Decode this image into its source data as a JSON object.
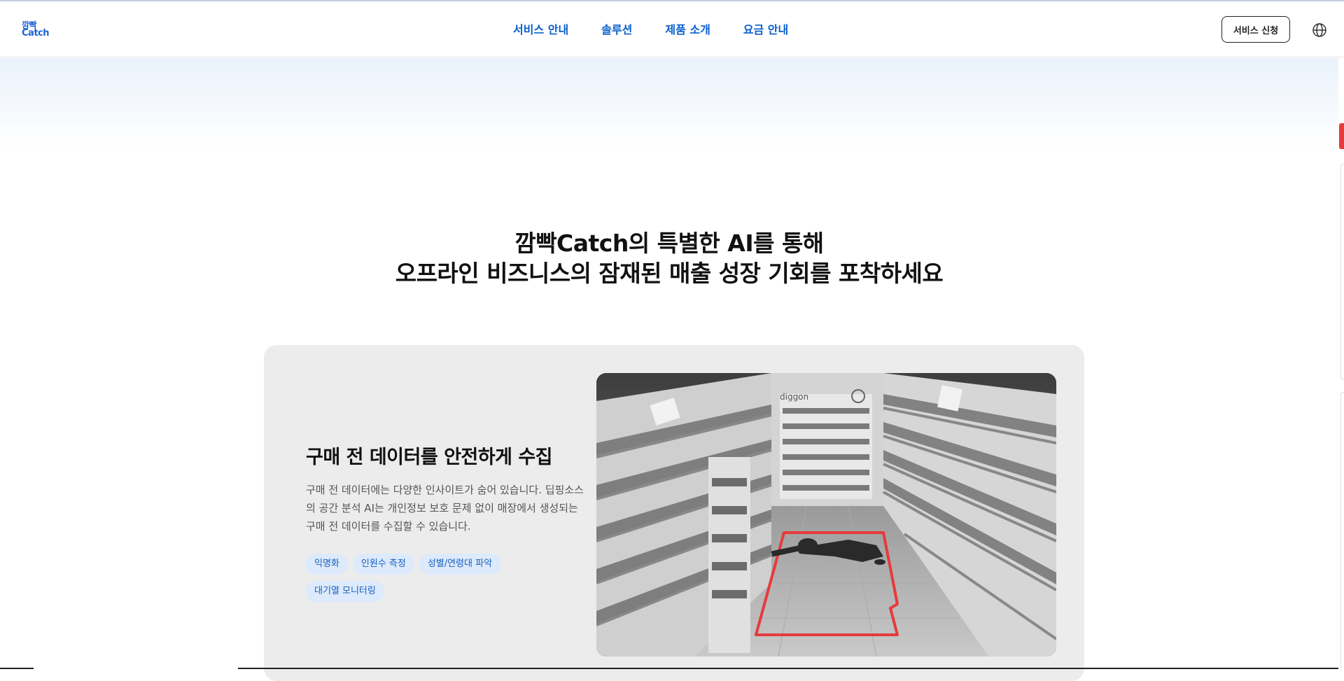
{
  "header": {
    "logo_line1": "깜빡",
    "logo_line2": "Catch",
    "nav": [
      "서비스 안내",
      "솔루션",
      "제품 소개",
      "요금 안내"
    ],
    "apply_button": "서비스 신청",
    "language_icon": "globe-icon"
  },
  "hero": {
    "headline_line1": "깜빡Catch의 특별한 AI를 통해",
    "headline_line2": "오프라인 비즈니스의 잠재된 매출 성장 기회를 포착하세요"
  },
  "feature": {
    "title": "구매 전 데이터를 안전하게 수집",
    "description": "구매 전 데이터에는 다양한 인사이트가 숨어 있습니다. 딥핑소스의 공간 분석 AI는 개인정보 보호 문제 없이 매장에서 생성되는 구매 전 데이터를 수집할 수 있습니다.",
    "tags": [
      "익명화",
      "인원수 측정",
      "성별/연령대 파악",
      "대기열 모니터링"
    ],
    "image_sign": "diggon"
  },
  "colors": {
    "brand_blue": "#0a5fc9",
    "tag_bg": "#dceafb",
    "card_bg": "#ececec",
    "highlight_red": "#e63b3b"
  }
}
